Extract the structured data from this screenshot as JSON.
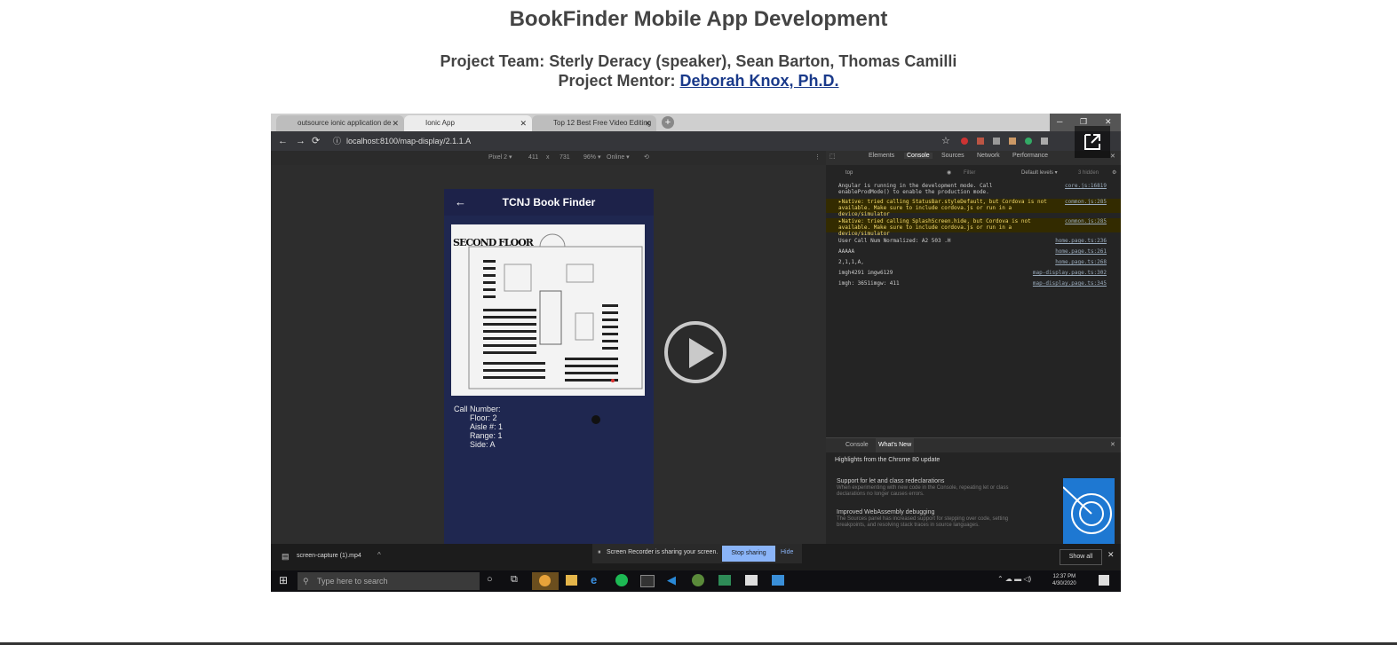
{
  "page": {
    "title": "BookFinder Mobile App Development",
    "team_label": "Project Team: Sterly Deracy (speaker), Sean Barton, Thomas Camilli",
    "mentor_prefix": "Project Mentor:",
    "mentor_name": "Deborah Knox, Ph.D."
  },
  "video": {
    "browser_tabs": [
      "outsource ionic application de",
      "Ionic App",
      "Top 12 Best Free Video Editing S"
    ],
    "url": "localhost:8100/map-display/2.1.1.A",
    "device_toolbar": {
      "device": "Pixel 2 ▾",
      "width": "411",
      "x": "x",
      "height": "731",
      "zoom": "96% ▾",
      "network": "Online ▾"
    },
    "devtools_tabs": [
      "Elements",
      "Console",
      "Sources",
      "Network",
      "Performance"
    ],
    "console_filter": "top",
    "console_filter_placeholder": "Filter",
    "console_levels": "Default levels ▾",
    "console_hidden": "3 hidden",
    "console_lines": [
      {
        "text": "Angular is running in the development mode. Call enableProdMode() to enable the production mode.",
        "src": "core.js:16819",
        "level": "info"
      },
      {
        "text": "▸Native: tried calling StatusBar.styleDefault, but Cordova is not available. Make sure to include cordova.js or run in a device/simulator",
        "src": "common.js:285",
        "level": "warn"
      },
      {
        "text": "▸Native: tried calling SplashScreen.hide, but Cordova is not available. Make sure to include cordova.js or run in a device/simulator",
        "src": "common.js:285",
        "level": "warn"
      },
      {
        "text": "User Call Num Normalized: A2 503 .H",
        "src": "home.page.ts:236",
        "level": "info"
      },
      {
        "text": "AAAAA",
        "src": "home.page.ts:261",
        "level": "info"
      },
      {
        "text": "2,1,1,A,",
        "src": "home.page.ts:268",
        "level": "info"
      },
      {
        "text": "imgh4291 imgw6129",
        "src": "map-display.page.ts:302",
        "level": "info"
      },
      {
        "text": "imgh: 3651imgw: 411",
        "src": "map-display.page.ts:345",
        "level": "info"
      }
    ],
    "phone": {
      "title": "TCNJ Book Finder",
      "map_label": "SECOND FLOOR",
      "call_number_label": "Call Number:",
      "floor": "Floor: 2",
      "aisle": "Aisle #: 1",
      "range": "Range: 1",
      "side": "Side: A"
    },
    "drawer": {
      "tabs": [
        "Console",
        "What's New"
      ],
      "heading": "Highlights from the Chrome 80 update",
      "items": [
        {
          "title": "Support for let and class redeclarations",
          "body": "When experimenting with new code in the Console, repeating let or class declarations no longer causes errors."
        },
        {
          "title": "Improved WebAssembly debugging",
          "body": "The Sources panel has increased support for stepping over code, setting breakpoints, and resolving stack traces in source languages."
        }
      ]
    },
    "download": "screen-capture (1).mp4",
    "share_message": "Screen Recorder is sharing your screen.",
    "stop_sharing": "Stop sharing",
    "hide": "Hide",
    "show_all": "Show all",
    "search_placeholder": "Type here to search",
    "clock_time": "12:37 PM",
    "clock_date": "4/30/2020"
  }
}
